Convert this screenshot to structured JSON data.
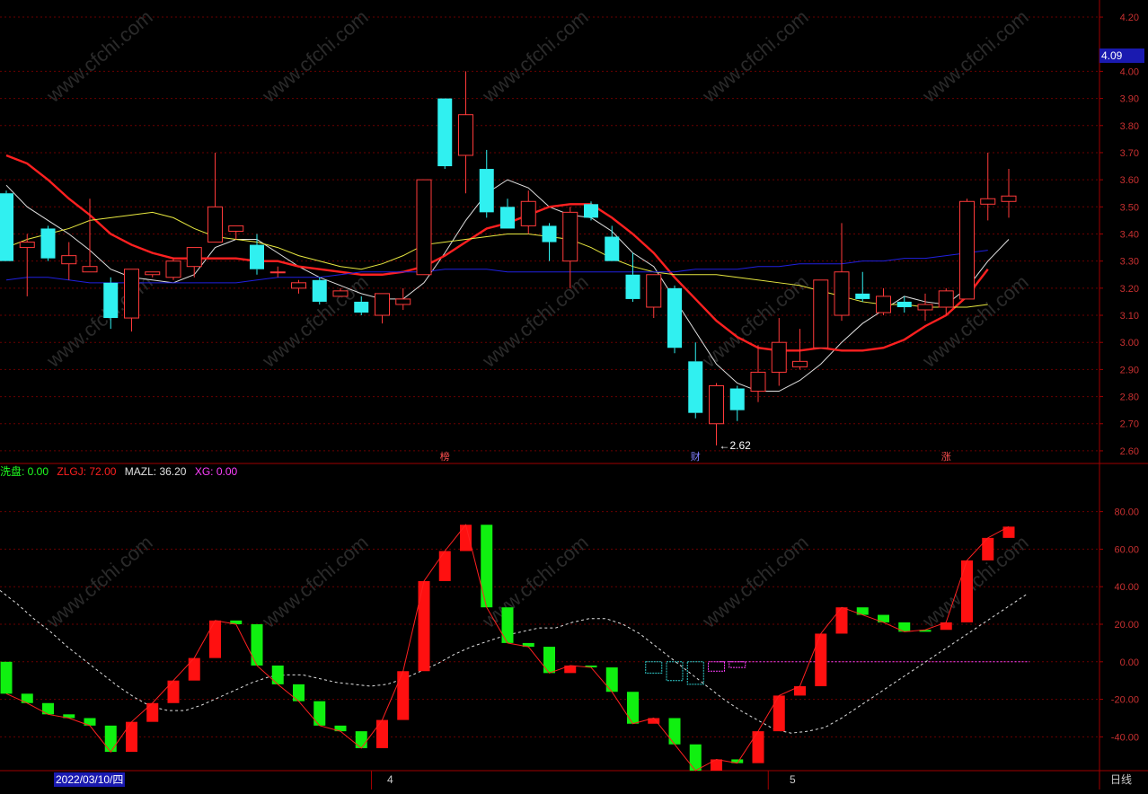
{
  "chart_data": [
    {
      "type": "candlestick",
      "panel": "main",
      "price_axis": {
        "ticks": [
          "2.60",
          "2.70",
          "2.80",
          "2.90",
          "3.00",
          "3.10",
          "3.20",
          "3.30",
          "3.40",
          "3.50",
          "3.60",
          "3.70",
          "3.80",
          "3.90",
          "4.00",
          "4.20"
        ],
        "ylim": [
          2.56,
          4.23
        ]
      },
      "current_price": "4.09",
      "low_annotation": "2.62",
      "candles": [
        {
          "o": 3.55,
          "h": 3.56,
          "l": 3.3,
          "c": 3.3
        },
        {
          "o": 3.35,
          "h": 3.4,
          "l": 3.17,
          "c": 3.37
        },
        {
          "o": 3.42,
          "h": 3.43,
          "l": 3.3,
          "c": 3.31
        },
        {
          "o": 3.29,
          "h": 3.37,
          "l": 3.23,
          "c": 3.32
        },
        {
          "o": 3.26,
          "h": 3.53,
          "l": 3.26,
          "c": 3.28
        },
        {
          "o": 3.22,
          "h": 3.24,
          "l": 3.05,
          "c": 3.09
        },
        {
          "o": 3.09,
          "h": 3.27,
          "l": 3.04,
          "c": 3.27
        },
        {
          "o": 3.25,
          "h": 3.26,
          "l": 3.24,
          "c": 3.26
        },
        {
          "o": 3.24,
          "h": 3.31,
          "l": 3.23,
          "c": 3.3
        },
        {
          "o": 3.28,
          "h": 3.33,
          "l": 3.24,
          "c": 3.35
        },
        {
          "o": 3.37,
          "h": 3.7,
          "l": 3.37,
          "c": 3.5
        },
        {
          "o": 3.41,
          "h": 3.43,
          "l": 3.38,
          "c": 3.43
        },
        {
          "o": 3.36,
          "h": 3.4,
          "l": 3.25,
          "c": 3.27
        },
        {
          "o": 3.26,
          "h": 3.28,
          "l": 3.24,
          "c": 3.26
        },
        {
          "o": 3.2,
          "h": 3.23,
          "l": 3.18,
          "c": 3.22
        },
        {
          "o": 3.23,
          "h": 3.24,
          "l": 3.14,
          "c": 3.15
        },
        {
          "o": 3.17,
          "h": 3.2,
          "l": 3.17,
          "c": 3.19
        },
        {
          "o": 3.15,
          "h": 3.17,
          "l": 3.1,
          "c": 3.11
        },
        {
          "o": 3.1,
          "h": 3.18,
          "l": 3.07,
          "c": 3.18
        },
        {
          "o": 3.14,
          "h": 3.2,
          "l": 3.12,
          "c": 3.16
        },
        {
          "o": 3.25,
          "h": 3.6,
          "l": 3.25,
          "c": 3.6
        },
        {
          "o": 3.9,
          "h": 3.9,
          "l": 3.64,
          "c": 3.65
        },
        {
          "o": 3.69,
          "h": 4.0,
          "l": 3.55,
          "c": 3.84
        },
        {
          "o": 3.64,
          "h": 3.71,
          "l": 3.46,
          "c": 3.48
        },
        {
          "o": 3.5,
          "h": 3.53,
          "l": 3.42,
          "c": 3.42
        },
        {
          "o": 3.43,
          "h": 3.56,
          "l": 3.4,
          "c": 3.52
        },
        {
          "o": 3.43,
          "h": 3.44,
          "l": 3.3,
          "c": 3.37
        },
        {
          "o": 3.3,
          "h": 3.5,
          "l": 3.2,
          "c": 3.48
        },
        {
          "o": 3.51,
          "h": 3.52,
          "l": 3.45,
          "c": 3.46
        },
        {
          "o": 3.39,
          "h": 3.43,
          "l": 3.3,
          "c": 3.3
        },
        {
          "o": 3.25,
          "h": 3.33,
          "l": 3.15,
          "c": 3.16
        },
        {
          "o": 3.13,
          "h": 3.25,
          "l": 3.09,
          "c": 3.25
        },
        {
          "o": 3.2,
          "h": 3.21,
          "l": 2.96,
          "c": 2.98
        },
        {
          "o": 2.93,
          "h": 3.0,
          "l": 2.72,
          "c": 2.74
        },
        {
          "o": 2.7,
          "h": 2.85,
          "l": 2.62,
          "c": 2.84
        },
        {
          "o": 2.83,
          "h": 2.84,
          "l": 2.71,
          "c": 2.75
        },
        {
          "o": 2.82,
          "h": 2.99,
          "l": 2.78,
          "c": 2.89
        },
        {
          "o": 2.89,
          "h": 3.09,
          "l": 2.84,
          "c": 3.0
        },
        {
          "o": 2.91,
          "h": 3.05,
          "l": 2.9,
          "c": 2.93
        },
        {
          "o": 2.98,
          "h": 3.23,
          "l": 2.98,
          "c": 3.23
        },
        {
          "o": 3.1,
          "h": 3.44,
          "l": 3.08,
          "c": 3.26
        },
        {
          "o": 3.18,
          "h": 3.26,
          "l": 3.15,
          "c": 3.16
        },
        {
          "o": 3.11,
          "h": 3.2,
          "l": 3.1,
          "c": 3.17
        },
        {
          "o": 3.15,
          "h": 3.17,
          "l": 3.11,
          "c": 3.13
        },
        {
          "o": 3.12,
          "h": 3.18,
          "l": 3.08,
          "c": 3.14
        },
        {
          "o": 3.13,
          "h": 3.2,
          "l": 3.1,
          "c": 3.19
        },
        {
          "o": 3.16,
          "h": 3.53,
          "l": 3.16,
          "c": 3.52
        },
        {
          "o": 3.51,
          "h": 3.7,
          "l": 3.45,
          "c": 3.53
        },
        {
          "o": 3.52,
          "h": 3.64,
          "l": 3.46,
          "c": 3.54
        }
      ],
      "ma_lines": [
        {
          "color": "#e0e0e0",
          "points": [
            3.58,
            3.5,
            3.45,
            3.4,
            3.34,
            3.27,
            3.24,
            3.23,
            3.22,
            3.25,
            3.35,
            3.38,
            3.38,
            3.33,
            3.28,
            3.24,
            3.21,
            3.18,
            3.16,
            3.16,
            3.22,
            3.33,
            3.45,
            3.55,
            3.6,
            3.57,
            3.5,
            3.47,
            3.46,
            3.41,
            3.33,
            3.28,
            3.16,
            3.04,
            2.92,
            2.85,
            2.82,
            2.82,
            2.86,
            2.92,
            3.0,
            3.07,
            3.12,
            3.17,
            3.15,
            3.14,
            3.2,
            3.3,
            3.38
          ]
        },
        {
          "color": "#ff2020",
          "points": [
            3.69,
            3.66,
            3.6,
            3.53,
            3.47,
            3.4,
            3.36,
            3.33,
            3.31,
            3.31,
            3.31,
            3.31,
            3.3,
            3.3,
            3.28,
            3.27,
            3.26,
            3.25,
            3.25,
            3.26,
            3.28,
            3.32,
            3.37,
            3.42,
            3.44,
            3.47,
            3.5,
            3.51,
            3.51,
            3.46,
            3.4,
            3.33,
            3.24,
            3.16,
            3.08,
            3.02,
            2.98,
            2.97,
            2.97,
            2.98,
            2.97,
            2.97,
            2.98,
            3.01,
            3.06,
            3.1,
            3.17,
            3.27
          ]
        },
        {
          "color": "#e8e840",
          "points": [
            3.35,
            3.38,
            3.4,
            3.42,
            3.45,
            3.46,
            3.47,
            3.48,
            3.46,
            3.42,
            3.39,
            3.38,
            3.37,
            3.35,
            3.32,
            3.3,
            3.28,
            3.27,
            3.29,
            3.32,
            3.36,
            3.37,
            3.38,
            3.39,
            3.4,
            3.4,
            3.39,
            3.38,
            3.35,
            3.31,
            3.28,
            3.26,
            3.25,
            3.25,
            3.25,
            3.24,
            3.23,
            3.22,
            3.21,
            3.19,
            3.17,
            3.15,
            3.14,
            3.14,
            3.13,
            3.13,
            3.13,
            3.14
          ]
        },
        {
          "color": "#2020e0",
          "points": [
            3.23,
            3.24,
            3.24,
            3.23,
            3.22,
            3.22,
            3.22,
            3.22,
            3.22,
            3.22,
            3.22,
            3.22,
            3.23,
            3.24,
            3.24,
            3.24,
            3.25,
            3.26,
            3.26,
            3.26,
            3.26,
            3.27,
            3.27,
            3.27,
            3.26,
            3.26,
            3.26,
            3.26,
            3.26,
            3.26,
            3.26,
            3.26,
            3.26,
            3.27,
            3.27,
            3.27,
            3.28,
            3.28,
            3.29,
            3.29,
            3.29,
            3.3,
            3.3,
            3.31,
            3.31,
            3.32,
            3.33,
            3.34
          ]
        }
      ],
      "event_markers": [
        {
          "label": "榜",
          "index": 21,
          "color": "#ff5050"
        },
        {
          "label": "财",
          "index": 33,
          "color": "#8080ff"
        },
        {
          "label": "涨",
          "index": 45,
          "color": "#ff5050"
        }
      ]
    },
    {
      "type": "bar",
      "panel": "indicator",
      "legend": [
        {
          "text": "洗盘: 0.00",
          "color": "#20ff20"
        },
        {
          "text": "ZLGJ: 72.00",
          "color": "#ff2020"
        },
        {
          "text": "MAZL: 36.20",
          "color": "#e0e0e0"
        },
        {
          "text": "XG: 0.00",
          "color": "#ff40ff"
        }
      ],
      "y_ticks": [
        "80.00",
        "60.00",
        "40.00",
        "20.00",
        "0.00",
        "-20.00",
        "-40.00"
      ],
      "ylim": [
        -58,
        98
      ],
      "bars": [
        {
          "from": 0,
          "to": -17,
          "color": "green"
        },
        {
          "from": -17,
          "to": -22,
          "color": "green"
        },
        {
          "from": -22,
          "to": -28,
          "color": "green"
        },
        {
          "from": -28,
          "to": -30,
          "color": "green"
        },
        {
          "from": -30,
          "to": -34,
          "color": "green"
        },
        {
          "from": -34,
          "to": -48,
          "color": "green"
        },
        {
          "from": -48,
          "to": -32,
          "color": "red"
        },
        {
          "from": -32,
          "to": -22,
          "color": "red"
        },
        {
          "from": -22,
          "to": -10,
          "color": "red"
        },
        {
          "from": -10,
          "to": 2,
          "color": "red"
        },
        {
          "from": 2,
          "to": 22,
          "color": "red"
        },
        {
          "from": 22,
          "to": 20,
          "color": "green"
        },
        {
          "from": 20,
          "to": -2,
          "color": "green"
        },
        {
          "from": -2,
          "to": -12,
          "color": "green"
        },
        {
          "from": -12,
          "to": -21,
          "color": "green"
        },
        {
          "from": -21,
          "to": -34,
          "color": "green"
        },
        {
          "from": -34,
          "to": -37,
          "color": "green"
        },
        {
          "from": -37,
          "to": -46,
          "color": "green"
        },
        {
          "from": -46,
          "to": -31,
          "color": "red"
        },
        {
          "from": -31,
          "to": -5,
          "color": "red"
        },
        {
          "from": -5,
          "to": 43,
          "color": "red"
        },
        {
          "from": 43,
          "to": 59,
          "color": "red"
        },
        {
          "from": 59,
          "to": 73,
          "color": "red"
        },
        {
          "from": 73,
          "to": 29,
          "color": "green"
        },
        {
          "from": 29,
          "to": 10,
          "color": "green"
        },
        {
          "from": 10,
          "to": 8,
          "color": "green"
        },
        {
          "from": 8,
          "to": -6,
          "color": "green"
        },
        {
          "from": -6,
          "to": -2,
          "color": "red"
        },
        {
          "from": -2,
          "to": -3,
          "color": "green"
        },
        {
          "from": -3,
          "to": -16,
          "color": "green"
        },
        {
          "from": -16,
          "to": -33,
          "color": "green"
        },
        {
          "from": -33,
          "to": -30,
          "color": "red"
        },
        {
          "from": -30,
          "to": -44,
          "color": "green"
        },
        {
          "from": -44,
          "to": -58,
          "color": "green"
        },
        {
          "from": -58,
          "to": -52,
          "color": "red"
        },
        {
          "from": -52,
          "to": -54,
          "color": "green"
        },
        {
          "from": -54,
          "to": -37,
          "color": "red"
        },
        {
          "from": -37,
          "to": -18,
          "color": "red"
        },
        {
          "from": -18,
          "to": -13,
          "color": "red"
        },
        {
          "from": -13,
          "to": 15,
          "color": "red"
        },
        {
          "from": 15,
          "to": 29,
          "color": "red"
        },
        {
          "from": 29,
          "to": 25,
          "color": "green"
        },
        {
          "from": 25,
          "to": 21,
          "color": "green"
        },
        {
          "from": 21,
          "to": 16,
          "color": "green"
        },
        {
          "from": 16,
          "to": 17,
          "color": "green"
        },
        {
          "from": 17,
          "to": 21,
          "color": "red"
        },
        {
          "from": 21,
          "to": 54,
          "color": "red"
        },
        {
          "from": 54,
          "to": 66,
          "color": "red"
        },
        {
          "from": 66,
          "to": 72,
          "color": "red"
        }
      ],
      "mazl_line": [
        38,
        31,
        23,
        16,
        8,
        1,
        -6,
        -13,
        -19,
        -24,
        -26,
        -26,
        -23,
        -19,
        -15,
        -11,
        -8,
        -7,
        -7,
        -9,
        -11,
        -12,
        -13,
        -12,
        -9,
        -5,
        -1,
        4,
        8,
        11,
        14,
        16,
        18,
        18,
        21,
        23,
        23,
        20,
        15,
        8,
        1,
        -6,
        -13,
        -20,
        -26,
        -31,
        -36,
        -38,
        -37,
        -35,
        -30,
        -24,
        -18,
        -12,
        -6,
        0,
        6,
        12,
        18,
        24,
        30,
        36
      ],
      "hollow_bars": [
        {
          "index": 31,
          "from": 0,
          "to": -6,
          "color": "#30d0d0"
        },
        {
          "index": 32,
          "from": 0,
          "to": -10,
          "color": "#30d0d0"
        },
        {
          "index": 33,
          "from": 0,
          "to": -12,
          "color": "#30d0d0"
        },
        {
          "index": 34,
          "from": 0,
          "to": -5,
          "color": "#ff40ff"
        },
        {
          "index": 35,
          "from": 0,
          "to": -3,
          "color": "#ff40ff"
        }
      ]
    }
  ],
  "time_axis": {
    "current_date": "2022/03/10/四",
    "month_labels": [
      {
        "label": "4",
        "index": 18
      },
      {
        "label": "5",
        "index": 37
      }
    ],
    "period": "日线"
  },
  "watermark": "www.cfchi.com"
}
